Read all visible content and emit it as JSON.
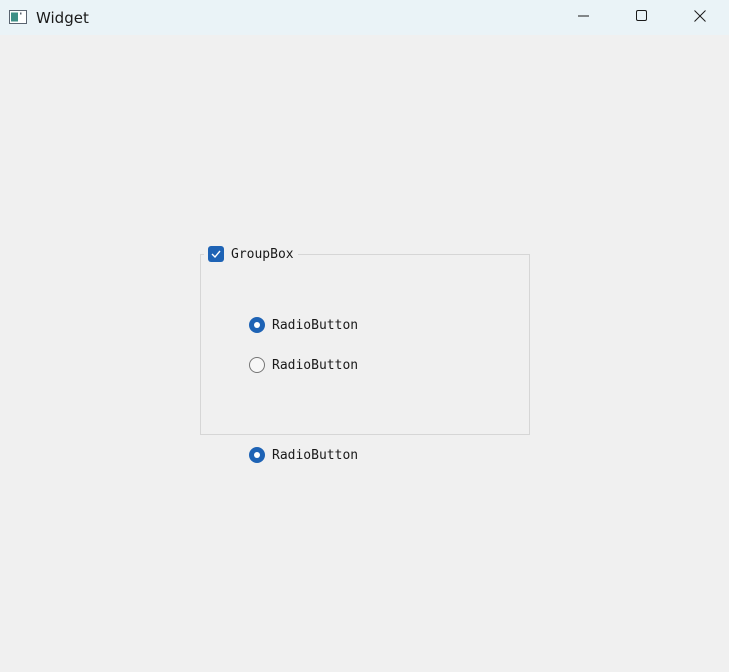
{
  "window": {
    "title": "Widget",
    "icon": "app-window-icon",
    "controls": {
      "minimize_icon": "minimize-icon",
      "maximize_icon": "maximize-icon",
      "close_icon": "close-icon"
    }
  },
  "groupbox": {
    "title": "GroupBox",
    "checkable": true,
    "checked": true,
    "radios": [
      {
        "label": "RadioButton",
        "checked": true
      },
      {
        "label": "RadioButton",
        "checked": false
      }
    ]
  },
  "standalone_radio": {
    "label": "RadioButton",
    "checked": true
  },
  "colors": {
    "accent": "#1e63b5",
    "background": "#f0f0f0",
    "titlebar": "#eaf3f7",
    "groupbox_border": "#d6d6d6"
  }
}
